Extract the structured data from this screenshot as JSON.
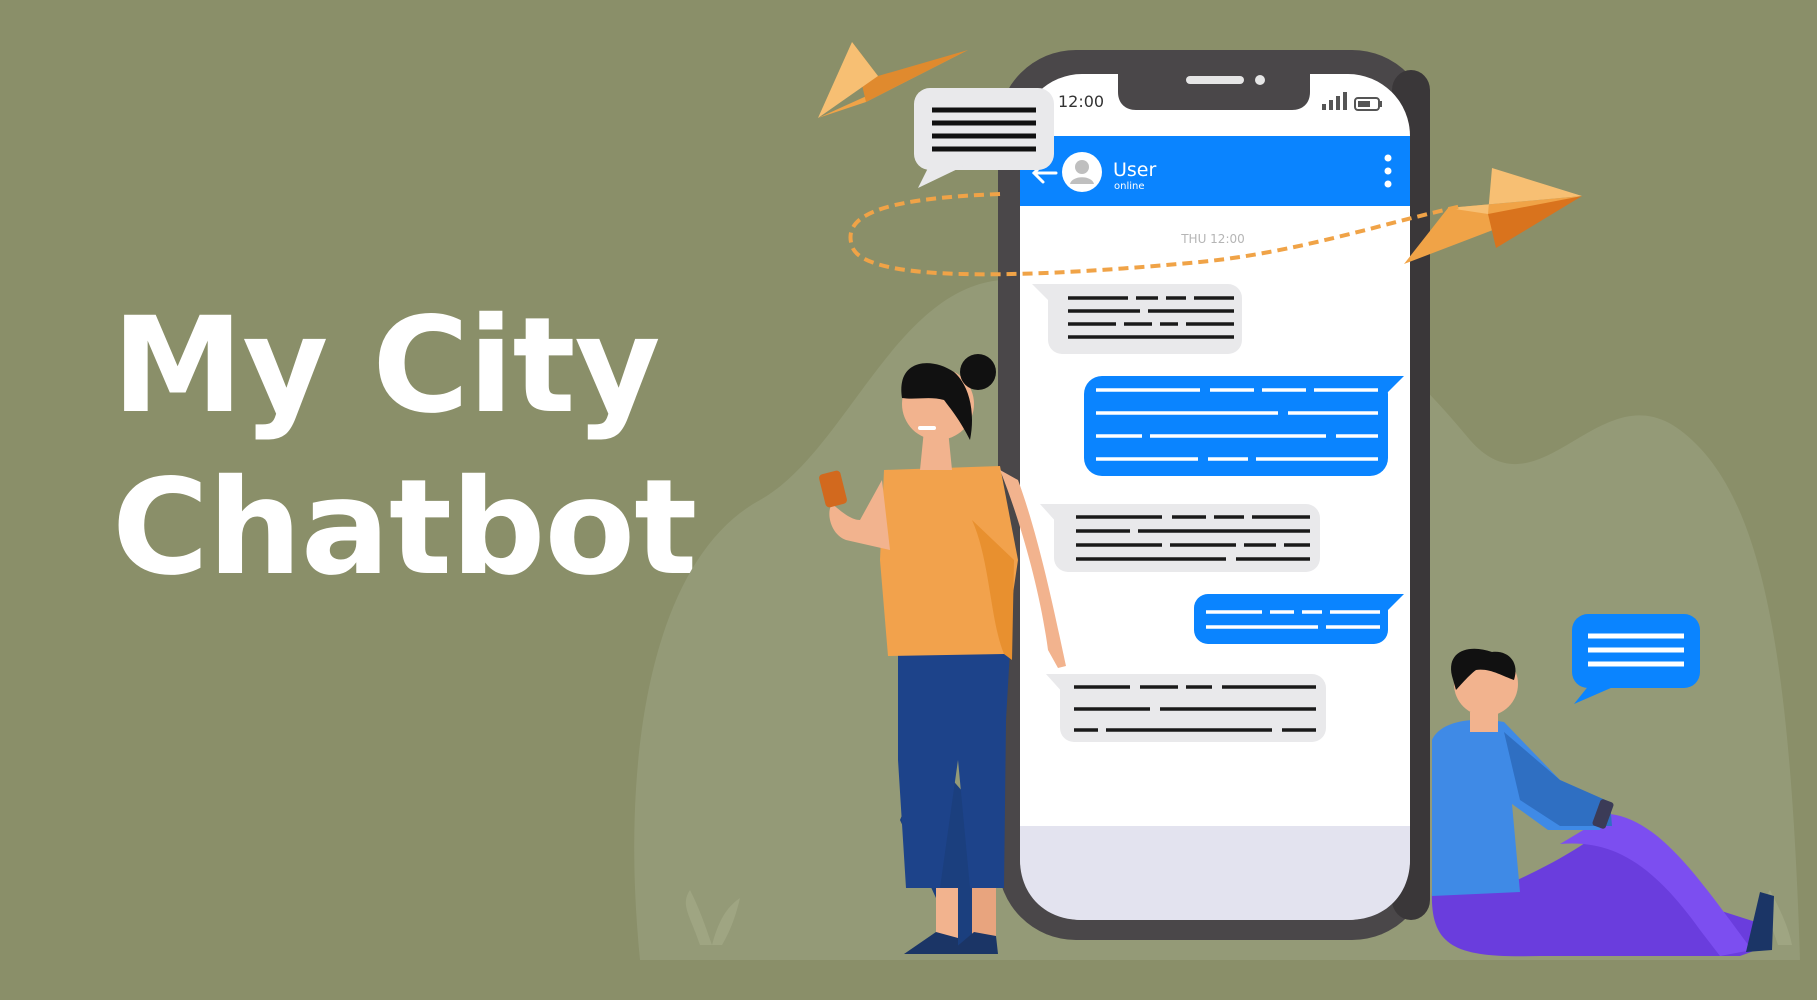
{
  "headline": {
    "line1": "My City",
    "line2": "Chatbot"
  },
  "phone": {
    "status_time": "12:00",
    "contact_name": "User",
    "contact_status": "online",
    "date_separator": "THU 12:00"
  },
  "icons": {
    "back": "arrow-left-icon",
    "menu": "vertical-dots-icon",
    "avatar": "user-avatar-icon",
    "signal": "signal-bars-icon",
    "battery": "battery-icon",
    "paper_plane": "paper-plane-icon",
    "speech_bubble": "speech-bubble-icon"
  },
  "colors": {
    "background": "#8a8f69",
    "background_shape": "#949a77",
    "accent_blue": "#0a84ff",
    "phone_frame": "#4a4749",
    "received_bubble": "#e9e9eb",
    "plane_orange": "#f0a347",
    "woman_top": "#f2a24c",
    "woman_pants": "#1b3f7e",
    "man_shirt": "#3f8ae6",
    "man_pants": "#6a3ddd",
    "hair": "#111111"
  }
}
